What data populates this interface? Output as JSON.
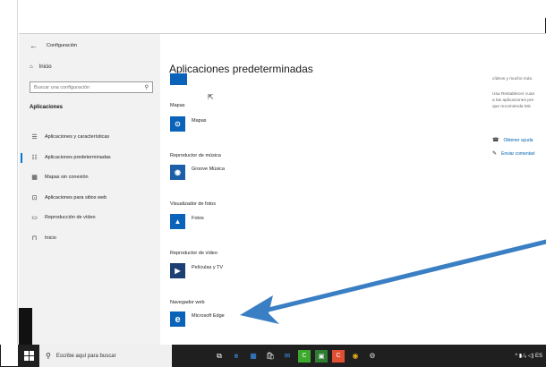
{
  "window": {
    "title": "Configuración"
  },
  "sidebar": {
    "home_label": "Inicio",
    "search_placeholder": "Buscar una configuración",
    "section_heading": "Aplicaciones",
    "items": [
      {
        "label": "Aplicaciones y características",
        "icon": "apps-list-icon"
      },
      {
        "label": "Aplicaciones predeterminadas",
        "icon": "default-apps-icon",
        "active": true
      },
      {
        "label": "Mapas sin conexión",
        "icon": "offline-maps-icon"
      },
      {
        "label": "Aplicaciones para sitios web",
        "icon": "apps-websites-icon"
      },
      {
        "label": "Reproducción de vídeo",
        "icon": "video-playback-icon"
      },
      {
        "label": "Inicio",
        "icon": "startup-icon"
      }
    ]
  },
  "main": {
    "title": "Aplicaciones predeterminadas",
    "sections": [
      {
        "label": "Mapas",
        "app": "Mapas",
        "color": "#0a63b8",
        "glyph": "⊙"
      },
      {
        "label": "Reproductor de música",
        "app": "Groove Música",
        "color": "#1c5fa8",
        "glyph": "◉"
      },
      {
        "label": "Visualizador de fotos",
        "app": "Fotos",
        "color": "#0a63b8",
        "glyph": "▲"
      },
      {
        "label": "Reproductor de vídeo",
        "app": "Películas y TV",
        "color": "#1d3f74",
        "glyph": "▶"
      },
      {
        "label": "Navegador web",
        "app": "Microsoft Edge",
        "color": "#0a63b8",
        "glyph": "e"
      }
    ]
  },
  "right_panel": {
    "line1": "vídeos y mucho más.",
    "para": [
      "Usa Restablecer cuan",
      "a las aplicaciones pre",
      "que recomienda Mic"
    ],
    "help_link": "Obtener ayuda",
    "feedback_link": "Enviar comentari"
  },
  "taskbar": {
    "search_placeholder": "Escribe aquí para buscar",
    "tray_text": "^ ▮ ⁄ₑ ◁) ES"
  },
  "colors": {
    "accent": "#0078d7",
    "arrow": "#3a7fc4",
    "taskbar": "#1f1f1f"
  }
}
